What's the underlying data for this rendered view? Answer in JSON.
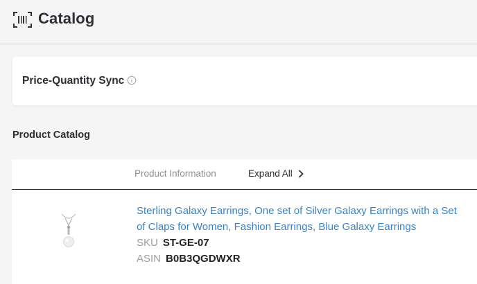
{
  "header": {
    "title": "Catalog",
    "icon": "barcode-icon"
  },
  "sync": {
    "label": "Price-Quantity Sync",
    "info_icon": "info-icon"
  },
  "catalog": {
    "section_title": "Product Catalog",
    "columns": {
      "product_information": "Product Information",
      "expand_all": "Expand All"
    },
    "products": [
      {
        "title": "Sterling Galaxy Earrings, One set of Silver Galaxy Earrings with a Set of Claps for Women, Fashion Earrings, Blue Galaxy Earrings",
        "sku_label": "SKU",
        "sku": "ST-GE-07",
        "asin_label": "ASIN",
        "asin": "B0B3QGDWXR"
      }
    ]
  },
  "colors": {
    "link": "#3b82c4",
    "background": "#f5f5f6",
    "card": "#ffffff",
    "muted": "#8b8f94"
  }
}
